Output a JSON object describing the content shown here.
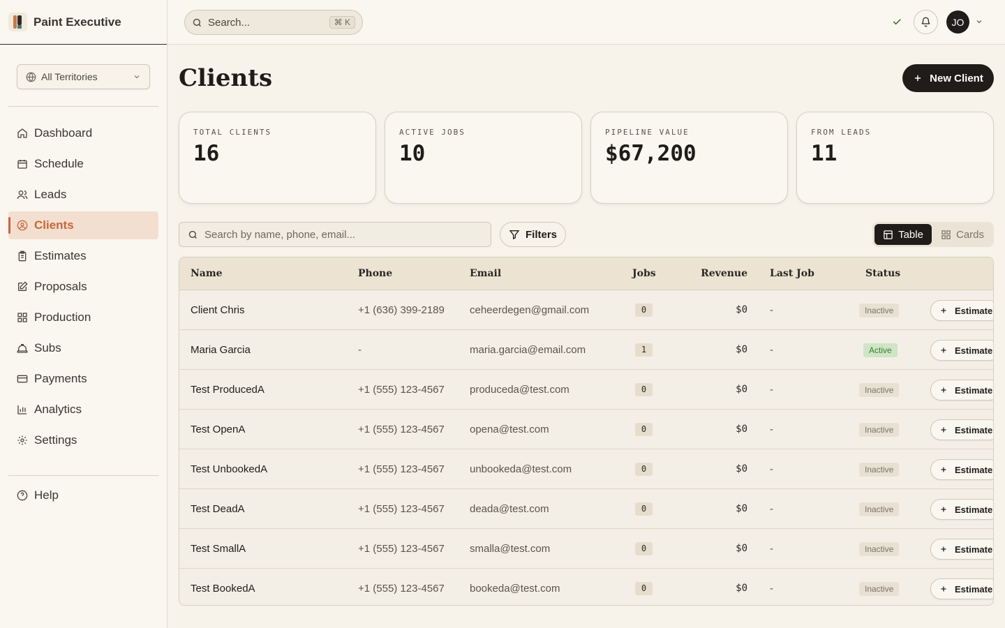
{
  "app": {
    "name": "Paint Executive"
  },
  "sidebar": {
    "territory": "All Territories",
    "items": [
      {
        "label": "Dashboard",
        "icon": "home-icon"
      },
      {
        "label": "Schedule",
        "icon": "calendar-icon"
      },
      {
        "label": "Leads",
        "icon": "users-icon"
      },
      {
        "label": "Clients",
        "icon": "user-circle-icon",
        "active": true
      },
      {
        "label": "Estimates",
        "icon": "clipboard-icon"
      },
      {
        "label": "Proposals",
        "icon": "pen-square-icon"
      },
      {
        "label": "Production",
        "icon": "grid-icon"
      },
      {
        "label": "Subs",
        "icon": "hard-hat-icon"
      },
      {
        "label": "Payments",
        "icon": "credit-card-icon"
      },
      {
        "label": "Analytics",
        "icon": "bar-chart-icon"
      },
      {
        "label": "Settings",
        "icon": "gear-icon"
      }
    ],
    "help": "Help"
  },
  "topbar": {
    "search_placeholder": "Search...",
    "shortcut": "⌘ K",
    "avatar_initials": "JO"
  },
  "page": {
    "title": "Clients",
    "new_button": "New Client"
  },
  "stats": [
    {
      "label": "TOTAL CLIENTS",
      "value": "16"
    },
    {
      "label": "ACTIVE JOBS",
      "value": "10"
    },
    {
      "label": "PIPELINE VALUE",
      "value": "$67,200"
    },
    {
      "label": "FROM LEADS",
      "value": "11"
    }
  ],
  "toolbar": {
    "search_placeholder": "Search by name, phone, email...",
    "filters": "Filters",
    "view_table": "Table",
    "view_cards": "Cards"
  },
  "table": {
    "headers": {
      "name": "Name",
      "phone": "Phone",
      "email": "Email",
      "jobs": "Jobs",
      "revenue": "Revenue",
      "last_job": "Last Job",
      "status": "Status"
    },
    "action_label": "Estimate",
    "rows": [
      {
        "name": "Client Chris",
        "phone": "+1 (636) 399-2189",
        "email": "ceheerdegen@gmail.com",
        "jobs": "0",
        "revenue": "$0",
        "last_job": "-",
        "status": "Inactive"
      },
      {
        "name": "Maria Garcia",
        "phone": "-",
        "email": "maria.garcia@email.com",
        "jobs": "1",
        "revenue": "$0",
        "last_job": "-",
        "status": "Active"
      },
      {
        "name": "Test ProducedA",
        "phone": "+1 (555) 123-4567",
        "email": "produceda@test.com",
        "jobs": "0",
        "revenue": "$0",
        "last_job": "-",
        "status": "Inactive"
      },
      {
        "name": "Test OpenA",
        "phone": "+1 (555) 123-4567",
        "email": "opena@test.com",
        "jobs": "0",
        "revenue": "$0",
        "last_job": "-",
        "status": "Inactive"
      },
      {
        "name": "Test UnbookedA",
        "phone": "+1 (555) 123-4567",
        "email": "unbookeda@test.com",
        "jobs": "0",
        "revenue": "$0",
        "last_job": "-",
        "status": "Inactive"
      },
      {
        "name": "Test DeadA",
        "phone": "+1 (555) 123-4567",
        "email": "deada@test.com",
        "jobs": "0",
        "revenue": "$0",
        "last_job": "-",
        "status": "Inactive"
      },
      {
        "name": "Test SmallA",
        "phone": "+1 (555) 123-4567",
        "email": "smalla@test.com",
        "jobs": "0",
        "revenue": "$0",
        "last_job": "-",
        "status": "Inactive"
      },
      {
        "name": "Test BookedA",
        "phone": "+1 (555) 123-4567",
        "email": "bookeda@test.com",
        "jobs": "0",
        "revenue": "$0",
        "last_job": "-",
        "status": "Inactive"
      }
    ]
  },
  "colors": {
    "accent": "#c8653a",
    "dark": "#1f1c1a",
    "active_status": "#3f7a32",
    "background": "#f7f3ea"
  }
}
